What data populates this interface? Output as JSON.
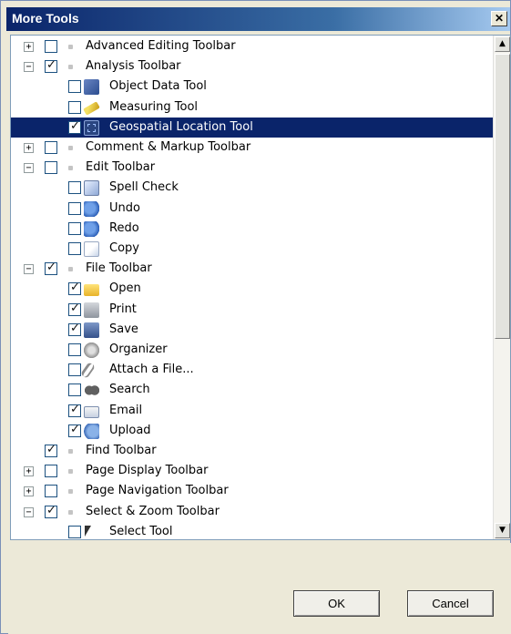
{
  "dialog": {
    "title": "More Tools",
    "close_label": "✕",
    "ok_label": "OK",
    "cancel_label": "Cancel"
  },
  "scrollbar": {
    "up_arrow": "▲",
    "down_arrow": "▼"
  },
  "tree": [
    {
      "label": "Advanced Editing Toolbar",
      "level": 0,
      "expander": "+",
      "checked": false,
      "icon": null
    },
    {
      "label": "Analysis Toolbar",
      "level": 0,
      "expander": "−",
      "checked": true,
      "icon": null
    },
    {
      "label": "Object Data Tool",
      "level": 1,
      "checked": false,
      "icon": "object-data-icon"
    },
    {
      "label": "Measuring Tool",
      "level": 1,
      "checked": false,
      "icon": "ruler-icon"
    },
    {
      "label": "Geospatial Location Tool",
      "level": 1,
      "checked": true,
      "icon": "geospatial-icon",
      "selected": true
    },
    {
      "label": "Comment & Markup Toolbar",
      "level": 0,
      "expander": "+",
      "checked": false,
      "icon": null
    },
    {
      "label": "Edit Toolbar",
      "level": 0,
      "expander": "−",
      "checked": false,
      "icon": null
    },
    {
      "label": "Spell Check",
      "level": 1,
      "checked": false,
      "icon": "spell-check-icon"
    },
    {
      "label": "Undo",
      "level": 1,
      "checked": false,
      "icon": "undo-icon"
    },
    {
      "label": "Redo",
      "level": 1,
      "checked": false,
      "icon": "redo-icon"
    },
    {
      "label": "Copy",
      "level": 1,
      "checked": false,
      "icon": "copy-icon"
    },
    {
      "label": "File Toolbar",
      "level": 0,
      "expander": "−",
      "checked": true,
      "icon": null
    },
    {
      "label": "Open",
      "level": 1,
      "checked": true,
      "icon": "folder-icon"
    },
    {
      "label": "Print",
      "level": 1,
      "checked": true,
      "icon": "printer-icon"
    },
    {
      "label": "Save",
      "level": 1,
      "checked": true,
      "icon": "save-icon"
    },
    {
      "label": "Organizer",
      "level": 1,
      "checked": false,
      "icon": "organizer-icon"
    },
    {
      "label": "Attach a File...",
      "level": 1,
      "checked": false,
      "icon": "paperclip-icon"
    },
    {
      "label": "Search",
      "level": 1,
      "checked": false,
      "icon": "binoculars-icon"
    },
    {
      "label": "Email",
      "level": 1,
      "checked": true,
      "icon": "envelope-icon"
    },
    {
      "label": "Upload",
      "level": 1,
      "checked": true,
      "icon": "upload-icon"
    },
    {
      "label": "Find Toolbar",
      "level": 0,
      "expander": null,
      "checked": true,
      "icon": null
    },
    {
      "label": "Page Display Toolbar",
      "level": 0,
      "expander": "+",
      "checked": false,
      "icon": null
    },
    {
      "label": "Page Navigation Toolbar",
      "level": 0,
      "expander": "+",
      "checked": false,
      "icon": null
    },
    {
      "label": "Select & Zoom Toolbar",
      "level": 0,
      "expander": "−",
      "checked": true,
      "icon": null
    },
    {
      "label": "Select Tool",
      "level": 1,
      "checked": false,
      "icon": "cursor-icon"
    }
  ]
}
